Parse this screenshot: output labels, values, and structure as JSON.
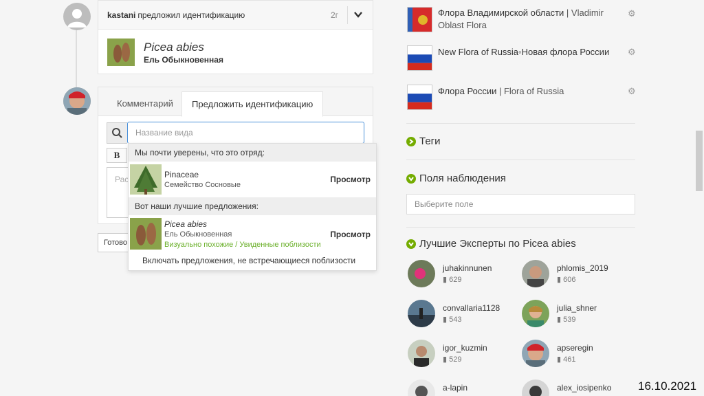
{
  "identification": {
    "user": "kastani",
    "action": "предложил идентификацию",
    "time": "2г",
    "taxon_sci": "Picea abies",
    "taxon_common": "Ель Обыкновенная"
  },
  "comment_form": {
    "tabs": [
      "Комментарий",
      "Предложить идентификацию"
    ],
    "active_tab": 1,
    "search_placeholder": "Название вида",
    "bold_label": "B",
    "textarea_placeholder": "Рас",
    "done_label": "Готово"
  },
  "dropdown": {
    "header1": "Мы почти уверены, что это отряд:",
    "item1": {
      "name": "Pinaceae",
      "common": "Семейство Сосновые",
      "view": "Просмотр"
    },
    "header2": "Вот наши лучшие предложения:",
    "item2": {
      "name": "Picea abies",
      "common": "Ель Обыкновенная",
      "note": "Визуально похожие / Увиденные поблизости",
      "view": "Просмотр"
    },
    "footer": "Включать предложения, не встречающиеся поблизости"
  },
  "projects": [
    {
      "title_bold": "Флора Владимирской области",
      "title_rest": " | Vladimir Oblast Flora",
      "flag": "vladimir"
    },
    {
      "title_bold": "",
      "title_rest": "New Flora of Russia◦Новая флора России",
      "flag": "russia"
    },
    {
      "title_bold": "Флора России",
      "title_rest": " | Flora of Russia",
      "flag": "russia"
    }
  ],
  "sections": {
    "tags": "Теги",
    "fields": "Поля наблюдения",
    "fields_placeholder": "Выберите поле",
    "experts_prefix": "Лучшие Эксперты по ",
    "experts_taxon": "Picea abies"
  },
  "experts": [
    {
      "username": "juhakinnunen",
      "count": "629"
    },
    {
      "username": "phlomis_2019",
      "count": "606"
    },
    {
      "username": "convallaria1128",
      "count": "543"
    },
    {
      "username": "julia_shner",
      "count": "539"
    },
    {
      "username": "igor_kuzmin",
      "count": "529"
    },
    {
      "username": "apseregin",
      "count": "461"
    },
    {
      "username": "a-lapin",
      "count": ""
    },
    {
      "username": "alex_iosipenko",
      "count": ""
    }
  ],
  "date_stamp": "16.10.2021",
  "colors": {
    "accent_green": "#74ac00",
    "link_blue": "#4a90d9"
  }
}
